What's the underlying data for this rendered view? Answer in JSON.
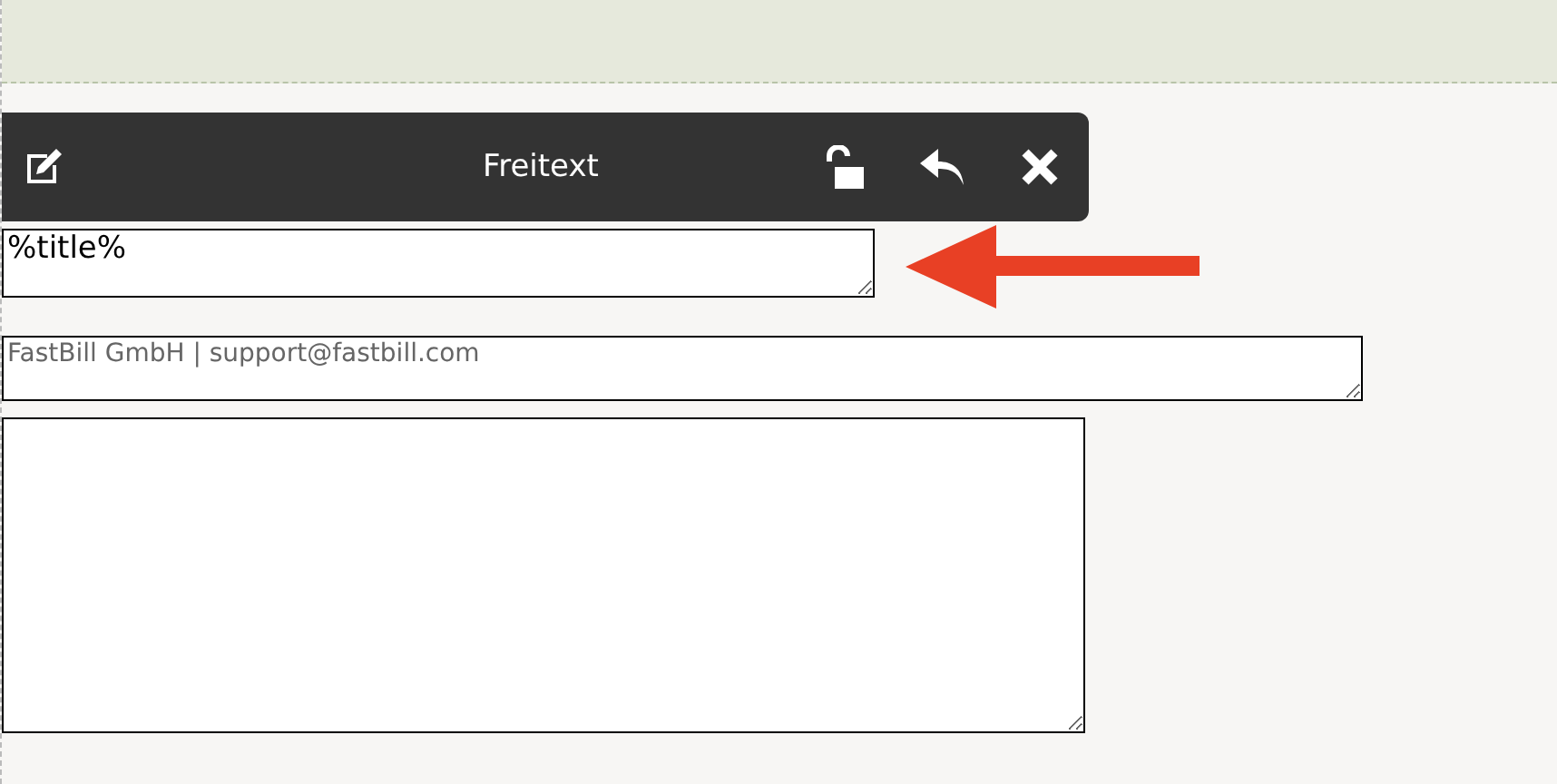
{
  "toolbar": {
    "title": "Freitext"
  },
  "fields": [
    {
      "value": "%title%",
      "kind": "title"
    },
    {
      "value": "FastBill GmbH | support@fastbill.com",
      "kind": "subtitle"
    },
    {
      "kind": "body"
    }
  ]
}
